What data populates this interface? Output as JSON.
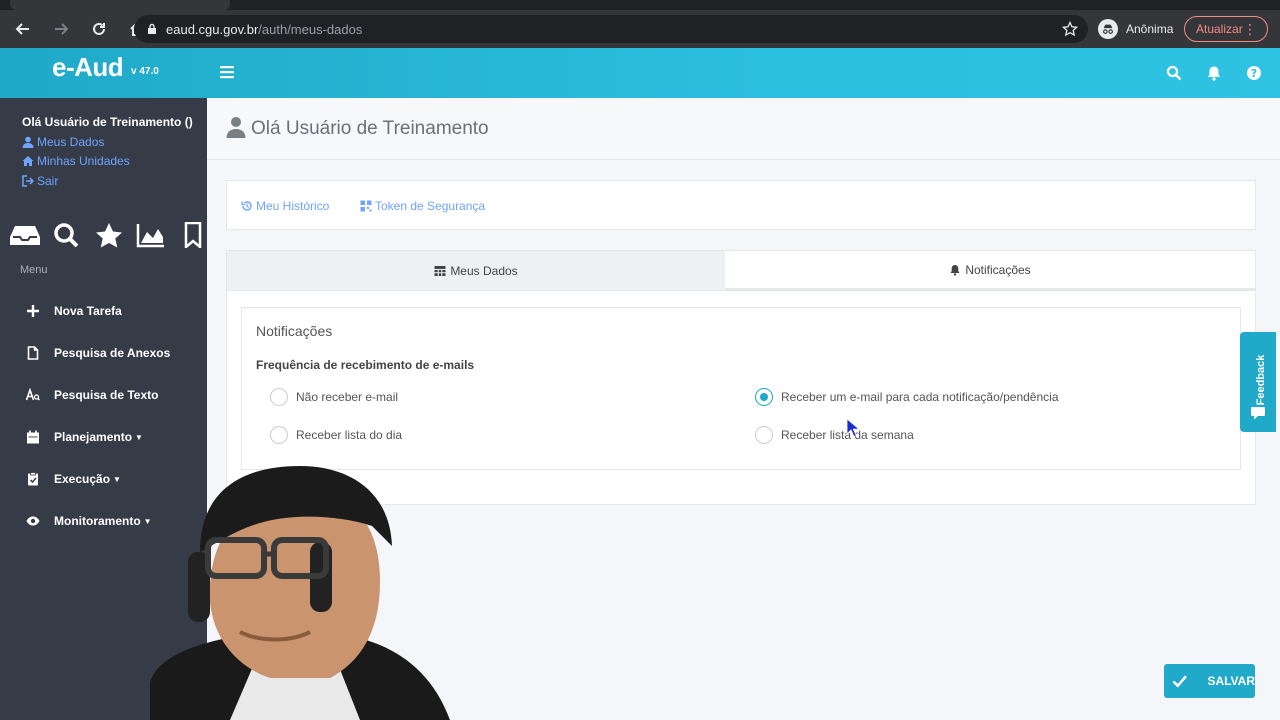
{
  "browser": {
    "url_host": "eaud.cgu.gov.br",
    "url_path": "/auth/meus-dados",
    "profile_label": "Anônima",
    "update_label": "Atualizar"
  },
  "header": {
    "brand": "e-Aud",
    "version": "v 47.0"
  },
  "sidebar": {
    "user_greeting": "Olá Usuário de Treinamento ()",
    "user_links": [
      {
        "label": "Meus Dados",
        "icon": "user-icon"
      },
      {
        "label": "Minhas Unidades",
        "icon": "home-icon"
      },
      {
        "label": "Sair",
        "icon": "sign-out-icon"
      }
    ],
    "menu_label": "Menu",
    "menu_items": [
      {
        "label": "Nova Tarefa",
        "icon": "plus-icon"
      },
      {
        "label": "Pesquisa de Anexos",
        "icon": "file-icon"
      },
      {
        "label": "Pesquisa de Texto",
        "icon": "text-search-icon"
      },
      {
        "label": "Planejamento",
        "icon": "calendar-icon",
        "dropdown": true
      },
      {
        "label": "Execução",
        "icon": "clipboard-icon",
        "dropdown": true
      },
      {
        "label": "Monitoramento",
        "icon": "eye-icon",
        "dropdown": true
      }
    ]
  },
  "main": {
    "page_title": "Olá Usuário de Treinamento",
    "top_links": [
      {
        "label": "Meu Histórico",
        "icon": "history-icon"
      },
      {
        "label": "Token de Segurança",
        "icon": "qrcode-icon"
      }
    ],
    "tabs": [
      {
        "label": "Meus Dados",
        "icon": "table-icon",
        "active": false
      },
      {
        "label": "Notificações",
        "icon": "bell-icon",
        "active": true
      }
    ],
    "panel_title": "Notificações",
    "frequency_label": "Frequência de recebimento de e-mails",
    "options": [
      {
        "label": "Não receber e-mail",
        "checked": false
      },
      {
        "label": "Receber um e-mail para cada notificação/pendência",
        "checked": true
      },
      {
        "label": "Receber lista do dia",
        "checked": false
      },
      {
        "label": "Receber lista da semana",
        "checked": false
      }
    ]
  },
  "feedback_label": "Feedback",
  "save_label": "SALVAR",
  "colors": {
    "accent": "#20a9c8",
    "sidebar": "#353c48",
    "link": "#6fa4ff"
  }
}
